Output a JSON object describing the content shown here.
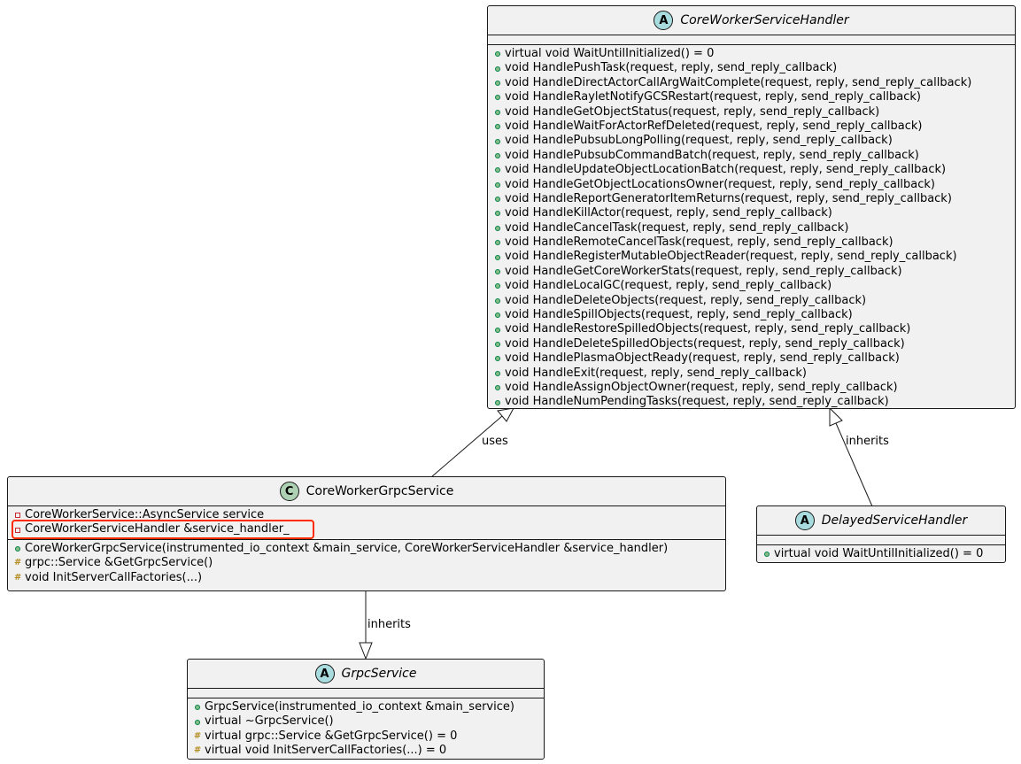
{
  "classes": {
    "core_worker_service_handler": {
      "stereotype": "A",
      "name": "CoreWorkerServiceHandler",
      "fields": [],
      "methods": [
        {
          "vis": "+",
          "text": "virtual void WaitUntilInitialized() = 0"
        },
        {
          "vis": "+",
          "text": "void HandlePushTask(request, reply, send_reply_callback)"
        },
        {
          "vis": "+",
          "text": "void HandleDirectActorCallArgWaitComplete(request, reply, send_reply_callback)"
        },
        {
          "vis": "+",
          "text": "void HandleRayletNotifyGCSRestart(request, reply, send_reply_callback)"
        },
        {
          "vis": "+",
          "text": "void HandleGetObjectStatus(request, reply, send_reply_callback)"
        },
        {
          "vis": "+",
          "text": "void HandleWaitForActorRefDeleted(request, reply, send_reply_callback)"
        },
        {
          "vis": "+",
          "text": "void HandlePubsubLongPolling(request, reply, send_reply_callback)"
        },
        {
          "vis": "+",
          "text": "void HandlePubsubCommandBatch(request, reply, send_reply_callback)"
        },
        {
          "vis": "+",
          "text": "void HandleUpdateObjectLocationBatch(request, reply, send_reply_callback)"
        },
        {
          "vis": "+",
          "text": "void HandleGetObjectLocationsOwner(request, reply, send_reply_callback)"
        },
        {
          "vis": "+",
          "text": "void HandleReportGeneratorItemReturns(request, reply, send_reply_callback)"
        },
        {
          "vis": "+",
          "text": "void HandleKillActor(request, reply, send_reply_callback)"
        },
        {
          "vis": "+",
          "text": "void HandleCancelTask(request, reply, send_reply_callback)"
        },
        {
          "vis": "+",
          "text": "void HandleRemoteCancelTask(request, reply, send_reply_callback)"
        },
        {
          "vis": "+",
          "text": "void HandleRegisterMutableObjectReader(request, reply, send_reply_callback)"
        },
        {
          "vis": "+",
          "text": "void HandleGetCoreWorkerStats(request, reply, send_reply_callback)"
        },
        {
          "vis": "+",
          "text": "void HandleLocalGC(request, reply, send_reply_callback)"
        },
        {
          "vis": "+",
          "text": "void HandleDeleteObjects(request, reply, send_reply_callback)"
        },
        {
          "vis": "+",
          "text": "void HandleSpillObjects(request, reply, send_reply_callback)"
        },
        {
          "vis": "+",
          "text": "void HandleRestoreSpilledObjects(request, reply, send_reply_callback)"
        },
        {
          "vis": "+",
          "text": "void HandleDeleteSpilledObjects(request, reply, send_reply_callback)"
        },
        {
          "vis": "+",
          "text": "void HandlePlasmaObjectReady(request, reply, send_reply_callback)"
        },
        {
          "vis": "+",
          "text": "void HandleExit(request, reply, send_reply_callback)"
        },
        {
          "vis": "+",
          "text": "void HandleAssignObjectOwner(request, reply, send_reply_callback)"
        },
        {
          "vis": "+",
          "text": "void HandleNumPendingTasks(request, reply, send_reply_callback)"
        }
      ]
    },
    "core_worker_grpc_service": {
      "stereotype": "C",
      "name": "CoreWorkerGrpcService",
      "fields": [
        {
          "vis": "-",
          "text": "CoreWorkerService::AsyncService service_"
        },
        {
          "vis": "-",
          "text": "CoreWorkerServiceHandler &service_handler_"
        }
      ],
      "methods": [
        {
          "vis": "+",
          "text": "CoreWorkerGrpcService(instrumented_io_context &main_service, CoreWorkerServiceHandler &service_handler)"
        },
        {
          "vis": "#",
          "text": "grpc::Service &GetGrpcService()"
        },
        {
          "vis": "#",
          "text": "void InitServerCallFactories(...)"
        }
      ]
    },
    "delayed_service_handler": {
      "stereotype": "A",
      "name": "DelayedServiceHandler",
      "fields": [],
      "methods": [
        {
          "vis": "+",
          "text": "virtual void WaitUntilInitialized() = 0"
        }
      ]
    },
    "grpc_service": {
      "stereotype": "A",
      "name": "GrpcService",
      "fields": [],
      "methods": [
        {
          "vis": "+",
          "text": "GrpcService(instrumented_io_context &main_service)"
        },
        {
          "vis": "+",
          "text": "virtual ~GrpcService()"
        },
        {
          "vis": "#",
          "text": "virtual grpc::Service &GetGrpcService() = 0"
        },
        {
          "vis": "#",
          "text": "virtual void InitServerCallFactories(...) = 0"
        }
      ]
    }
  },
  "relations": [
    {
      "from": "CoreWorkerGrpcService",
      "to": "CoreWorkerServiceHandler",
      "label": "uses"
    },
    {
      "from": "DelayedServiceHandler",
      "to": "CoreWorkerServiceHandler",
      "label": "inherits"
    },
    {
      "from": "CoreWorkerGrpcService",
      "to": "GrpcService",
      "label": "inherits"
    }
  ],
  "highlight": {
    "class": "CoreWorkerGrpcService",
    "member": "CoreWorkerServiceHandler &service_handler_",
    "color": "#ff2a00"
  },
  "colors": {
    "class_fill": "#f1f1f1",
    "abstract_badge": "#a9dcdf",
    "class_badge": "#add1b2",
    "public": "#84be84",
    "private": "#c82930",
    "protected": "#b38d22"
  }
}
